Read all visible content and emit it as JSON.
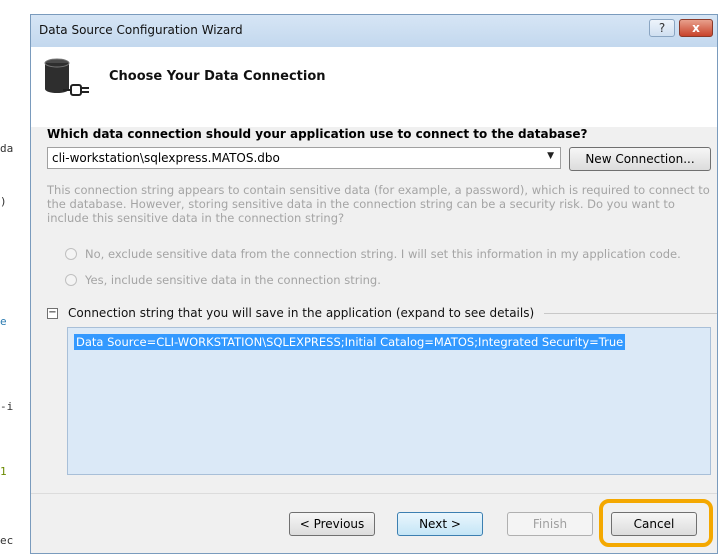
{
  "background_editor": {
    "fragments": [
      "da",
      ")",
      "e",
      "-i",
      "1",
      "ec"
    ]
  },
  "dialog": {
    "title": "Data Source Configuration Wizard",
    "help_label": "?",
    "close_label": "x",
    "header_title": "Choose Your Data Connection",
    "header_icon": "database-plug-icon",
    "question": "Which data connection should your application use to connect to the database?",
    "connection_value": "cli-workstation\\sqlexpress.MATOS.dbo",
    "dropdown_arrow": "▼",
    "new_connection_label": "New Connection...",
    "warning_text": "This connection string appears to contain sensitive data (for example, a password), which is required to connect to the database. However, storing sensitive data in the connection string can be a security risk. Do you want to include this sensitive data in the connection string?",
    "radio_options": [
      "No, exclude sensitive data from the connection string. I will set this information in my application code.",
      "Yes, include sensitive data in the connection string."
    ],
    "collapse_symbol": "−",
    "section_label": "Connection string that you will save in the application (expand to see details)",
    "connection_string": "Data Source=CLI-WORKSTATION\\SQLEXPRESS;Initial Catalog=MATOS;Integrated Security=True",
    "buttons": {
      "previous": "< Previous",
      "next": "Next >",
      "finish": "Finish",
      "cancel": "Cancel"
    },
    "highlight_color": "#f4a800"
  }
}
